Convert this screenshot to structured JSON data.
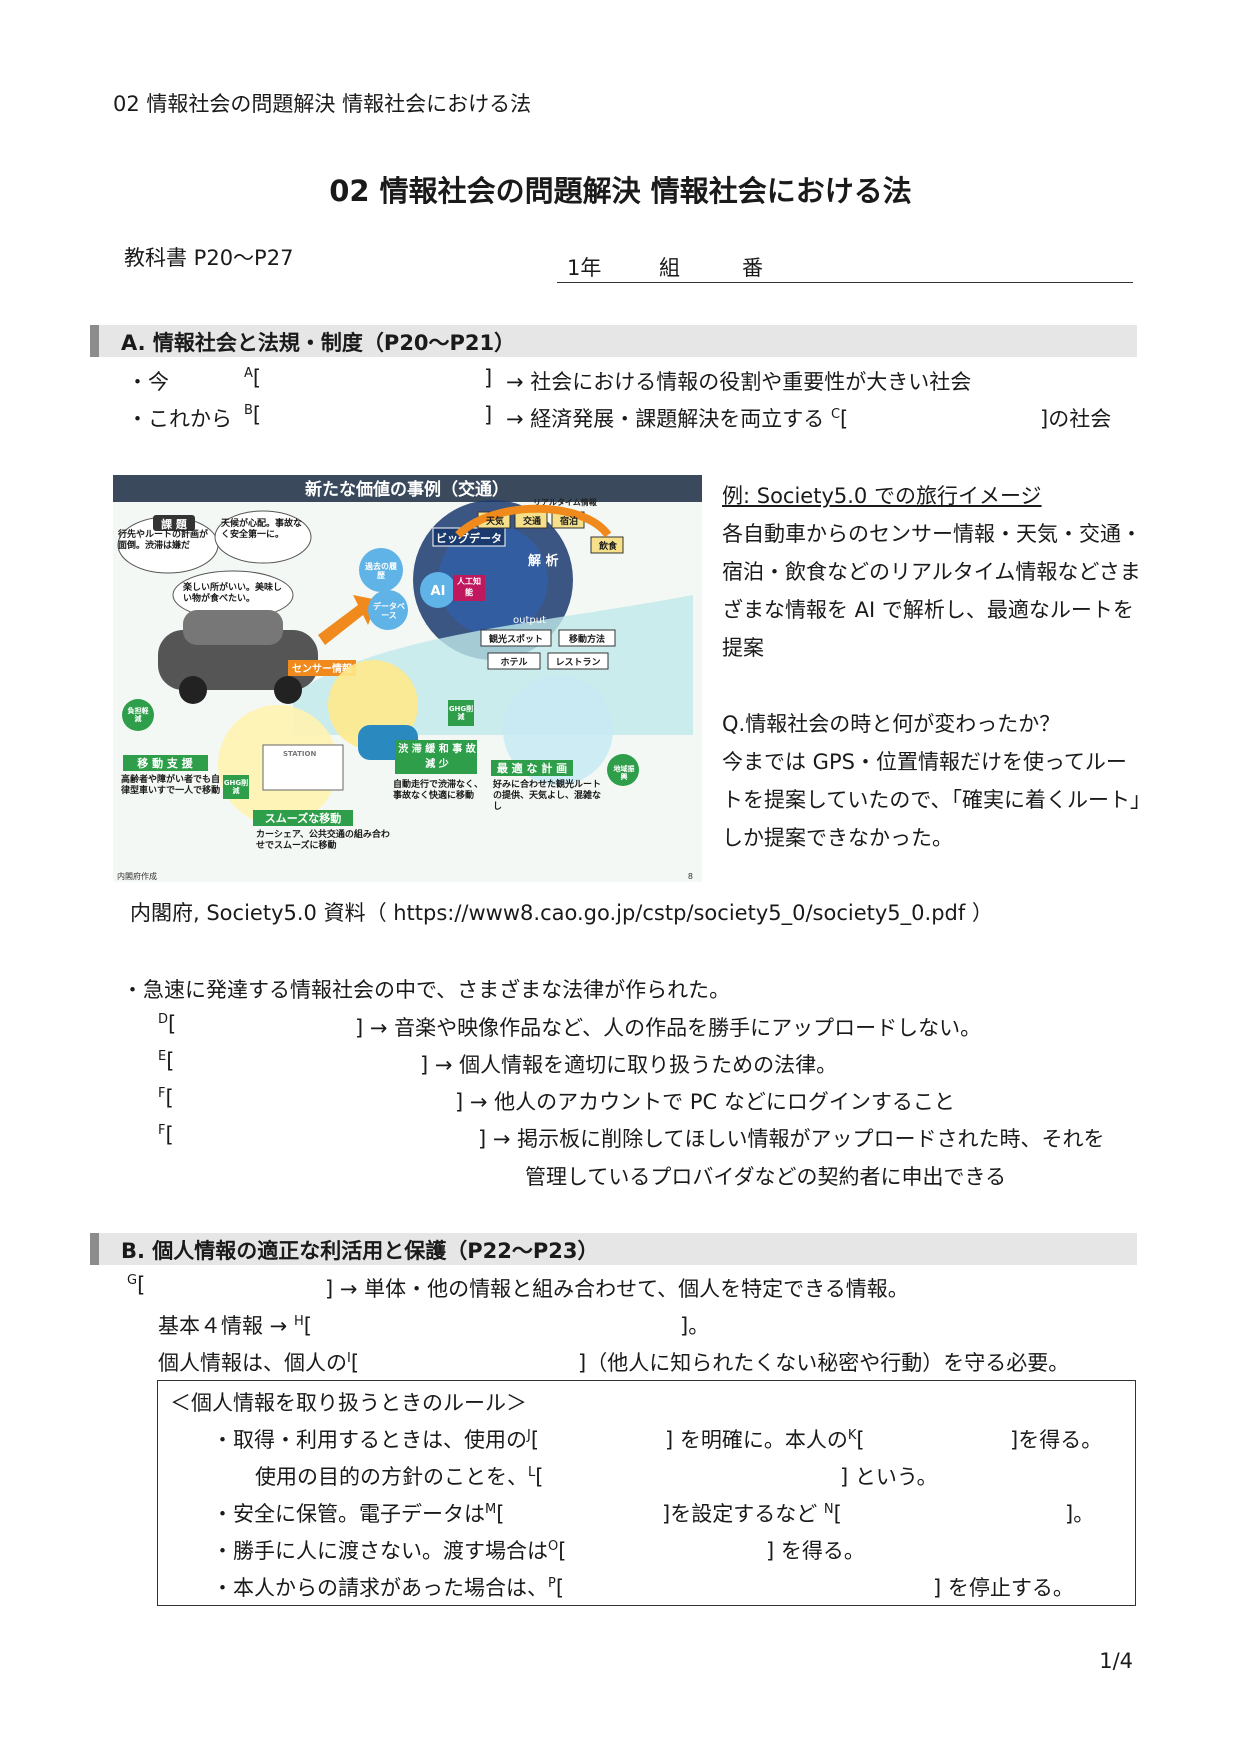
{
  "header": "02  情報社会の問題解決  情報社会における法",
  "title": "02  情報社会の問題解決  情報社会における法",
  "textbook": "教科書  P20～P27",
  "class_line": {
    "year": "1年",
    "group": "組",
    "number": "番"
  },
  "section_a": {
    "title": "A.  情報社会と法規・制度（P20～P21）",
    "now": {
      "prefix": "・今",
      "mark": "A",
      "open": "[",
      "close": "]",
      "desc": "→  社会における情報の役割や重要性が大きい社会"
    },
    "future": {
      "prefix": "・これから",
      "mark": "B",
      "open": "[",
      "close": "]",
      "desc": "→  経済発展・課題解決を両立する",
      "mark2": "C",
      "tail": "]の社会"
    }
  },
  "figure": {
    "title": "新たな価値の事例（交通）",
    "credit": "内閣府作成",
    "page": "8",
    "kadai": "課 題",
    "bubble1": "行先やルートの計画が面倒。渋滞は嫌だ",
    "bubble2": "天候が心配。事故なく安全第一に。",
    "bubble3": "楽しい所がいい。美味しい物が食べたい。",
    "realtime": "リアルタイム情報",
    "tags_top": [
      "天気",
      "交通",
      "宿泊",
      "飲食"
    ],
    "bigdata": "ビッグデータ",
    "kaiseki": "解 析",
    "past": "過去の履歴",
    "database": "データベース",
    "ai": "AI",
    "ai_label": "人工知能",
    "output": "output",
    "tags_out": [
      "観光スポット",
      "移動方法",
      "ホテル",
      "レストラン"
    ],
    "sensor": "センサー情報",
    "futan": "負担軽減",
    "ghg": "GHG削減",
    "station": "STATION",
    "idou": "移 動 支 援",
    "idou_text": "高齢者や障がい者でも自律型車いすで一人で移動",
    "smooth": "スムーズな移動",
    "smooth_text": "カーシェア、公共交通の組み合わせでスムーズに移動",
    "jutai": "渋 滞 緩 和 事 故 減 少",
    "jutai_text": "自動走行で渋滞なく、事故なく快適に移動",
    "saiteki": "最 適 な 計 画",
    "saiteki_text": "好みに合わせた観光ルートの提供、天気よし、混雑なし",
    "chiiki": "地域振興"
  },
  "example": {
    "title": "例: Society5.0 での旅行イメージ",
    "lines": [
      "各自動車からのセンサー情報・天気・交通・",
      "宿泊・飲食などのリアルタイム情報などさま",
      "ざまな情報を AI で解析し、最適なルートを",
      "提案"
    ],
    "question": "Q.情報社会の時と何が変わったか？",
    "answer": [
      "今までは GPS・位置情報だけを使ってルー",
      "トを提案していたので、「確実に着くルート」",
      "しか提案できなかった。"
    ]
  },
  "source": "内閣府, Society5.0  資料（ https://www8.cao.go.jp/cstp/society5_0/society5_0.pdf ）",
  "laws": {
    "intro": "・急速に発達する情報社会の中で、さまざまな法律が作られた。",
    "items": [
      {
        "mark": "D",
        "open": "[",
        "close": "]",
        "desc": "→  音楽や映像作品など、人の作品を勝手にアップロードしない。"
      },
      {
        "mark": "E",
        "open": "[",
        "close": "]",
        "desc": "→  個人情報を適切に取り扱うための法律。"
      },
      {
        "mark": "F",
        "open": "[",
        "close": "]",
        "desc": "→  他人のアカウントで PC などにログインすること"
      },
      {
        "mark": "F",
        "open": "[",
        "close": "]",
        "desc": "→  掲示板に削除してほしい情報がアップロードされた時、それを"
      }
    ],
    "continuation": "管理しているプロバイダなどの契約者に申出できる"
  },
  "section_b": {
    "title": "B.  個人情報の適正な利活用と保護（P22～P23）",
    "g": {
      "mark": "G",
      "open": "[",
      "close": "]",
      "desc": "→  単体・他の情報と組み合わせて、個人を特定できる情報。"
    },
    "h": {
      "prefix": "基本４情報  →",
      "mark": "H",
      "open": "[",
      "close": "]。"
    },
    "i": {
      "prefix": "個人情報は、個人の",
      "mark": "I",
      "open": "[",
      "close": "]（他人に知られたくない秘密や行動）を守る必要。"
    }
  },
  "rules": {
    "title": "＜個人情報を取り扱うときのルール＞",
    "r1": {
      "prefix": "・取得・利用するときは、使用の",
      "mark": "J",
      "open": "[",
      "close": "] を明確に。本人の",
      "mark2": "K",
      "open2": "[",
      "close2": "]を得る。"
    },
    "r2": {
      "prefix": "使用の目的の方針のことを、",
      "mark": "L",
      "open": "[",
      "close": "] という。"
    },
    "r3": {
      "prefix": "・安全に保管。電子データは",
      "mark": "M",
      "open": "[",
      "close": "]を設定するなど",
      "mark2": "N",
      "open2": "[",
      "close2": "]。"
    },
    "r4": {
      "prefix": "・勝手に人に渡さない。渡す場合は",
      "mark": "O",
      "open": "[",
      "close": "] を得る。"
    },
    "r5": {
      "prefix": "・本人からの請求があった場合は、",
      "mark": "P",
      "open": "[",
      "close": "] を停止する。"
    }
  },
  "page_num": "1/4"
}
